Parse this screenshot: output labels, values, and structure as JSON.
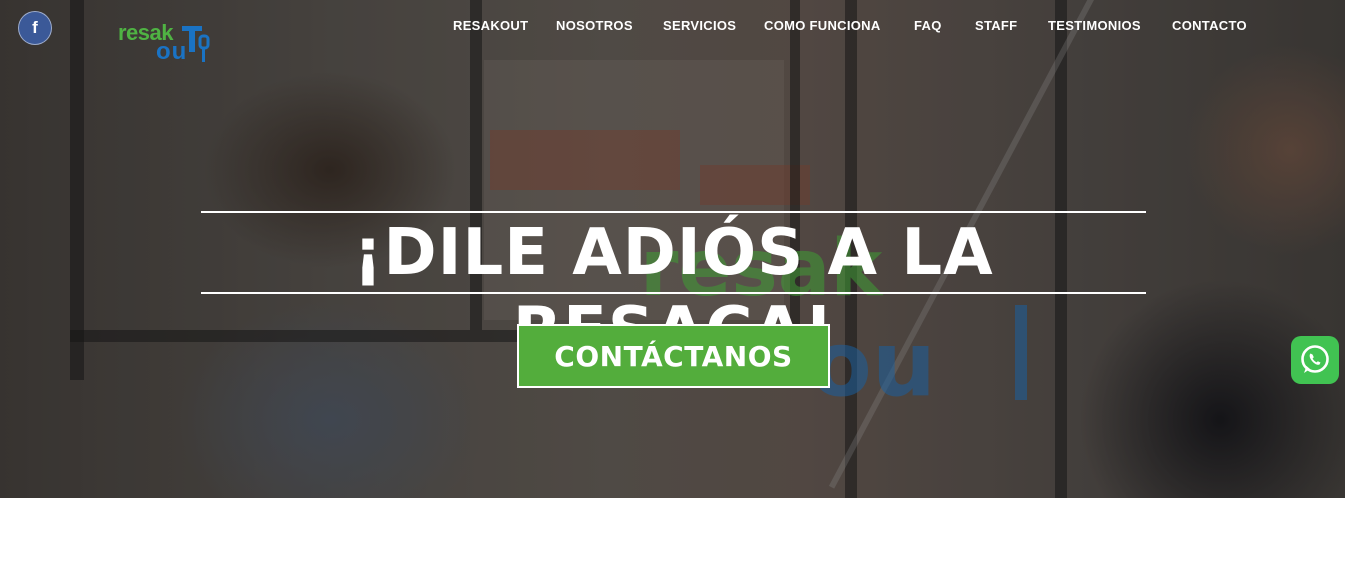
{
  "social": {
    "facebook_icon": "f"
  },
  "logo": {
    "top": "resak",
    "bottom": "ou"
  },
  "nav": {
    "items": [
      "RESAKOUT",
      "NOSOTROS",
      "SERVICIOS",
      "COMO FUNCIONA",
      "FAQ",
      "STAFF",
      "TESTIMONIOS",
      "CONTACTO"
    ]
  },
  "hero": {
    "headline": "¡DILE ADIÓS A LA RESACA!",
    "cta_label": "CONTÁCTANOS"
  },
  "colors": {
    "cta_green": "#53ad3c",
    "logo_green": "#4fb343",
    "logo_blue": "#1a73c4",
    "facebook_blue": "#3b5998",
    "whatsapp_green": "#41c352"
  },
  "icons": [
    "facebook-icon",
    "whatsapp-icon"
  ]
}
